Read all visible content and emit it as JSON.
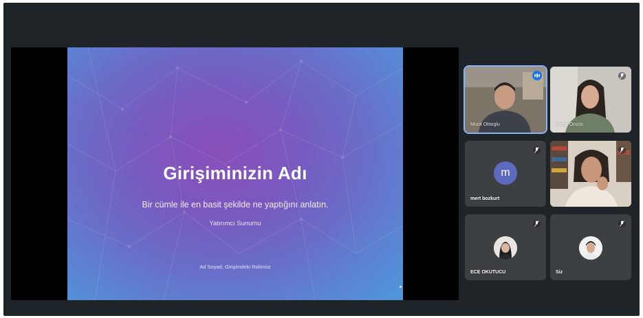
{
  "slide": {
    "title": "Girişiminizin Adı",
    "subtitle": "Bir cümle ile en basit şekilde ne yaptığını anlatın.",
    "tagline": "Yatırımcı Sunumu",
    "author_line": "Ad Soyad, Girişimdeki Rolünüz"
  },
  "participants": [
    {
      "name": "Mucit Oktoglu",
      "type": "video",
      "speaking": true
    },
    {
      "name": "Hazal Orucic",
      "type": "video",
      "speaking": false,
      "muted": true
    },
    {
      "name": "mert bozkurt",
      "type": "avatar-letter",
      "initial": "m",
      "muted": true
    },
    {
      "name": "",
      "type": "video",
      "muted": true
    },
    {
      "name": "ECE OKUTUCU",
      "type": "avatar-photo",
      "muted": true
    },
    {
      "name": "Siz",
      "type": "avatar-photo",
      "muted": true
    }
  ],
  "icons": {
    "mic_off": "mic-off-icon",
    "speaking": "speaking-indicator-icon"
  },
  "colors": {
    "background": "#1f2428",
    "tile": "#3c4043",
    "accent": "#1a73e8",
    "avatar": "#5c6bc0"
  }
}
